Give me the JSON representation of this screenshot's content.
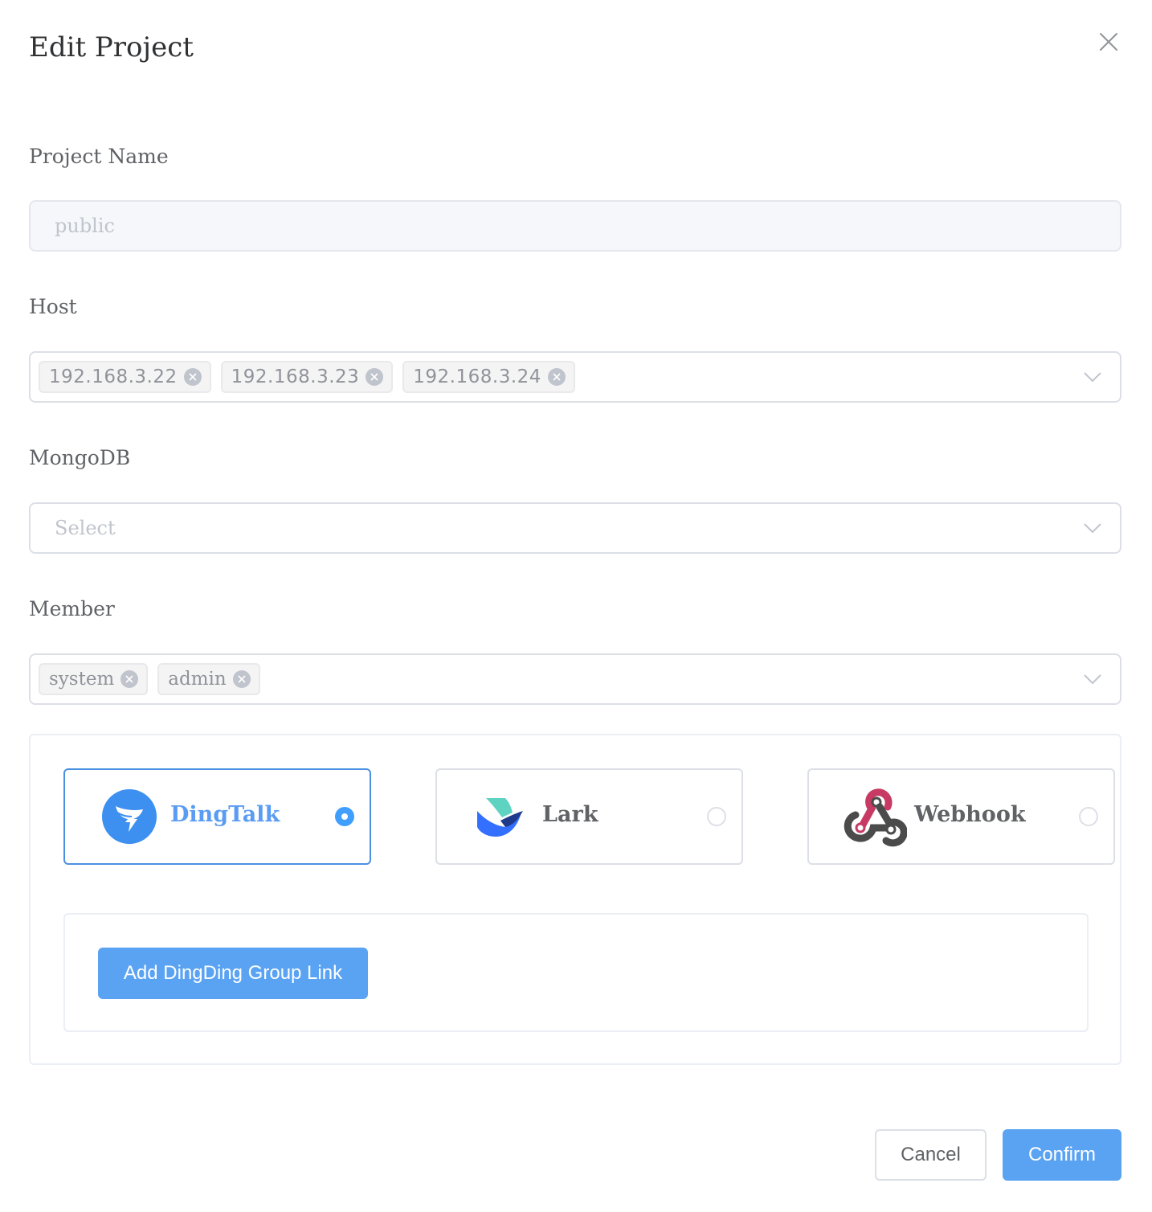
{
  "dialog": {
    "title": "Edit Project"
  },
  "project_name": {
    "label": "Project Name",
    "value": "public"
  },
  "host": {
    "label": "Host",
    "tags": [
      "192.168.3.22",
      "192.168.3.23",
      "192.168.3.24"
    ]
  },
  "mongodb": {
    "label": "MongoDB",
    "placeholder": "Select"
  },
  "member": {
    "label": "Member",
    "tags": [
      "system",
      "admin"
    ]
  },
  "notify": {
    "channels": [
      {
        "name": "DingTalk",
        "icon": "dingtalk-logo-icon",
        "selected": true
      },
      {
        "name": "Lark",
        "icon": "lark-logo-icon",
        "selected": false
      },
      {
        "name": "Webhook",
        "icon": "webhook-logo-icon",
        "selected": false
      }
    ],
    "add_link_label": "Add DingDing Group Link"
  },
  "footer": {
    "cancel_label": "Cancel",
    "confirm_label": "Confirm"
  },
  "colors": {
    "primary": "#409eff",
    "button_blue": "#5aa3f3",
    "border": "#dcdfe6",
    "webhook_red": "#c73a63",
    "webhook_dark": "#4b4b4b",
    "lark_teal": "#5fd3c1",
    "lark_blue": "#3370ff",
    "lark_navy": "#1f3a8a"
  }
}
